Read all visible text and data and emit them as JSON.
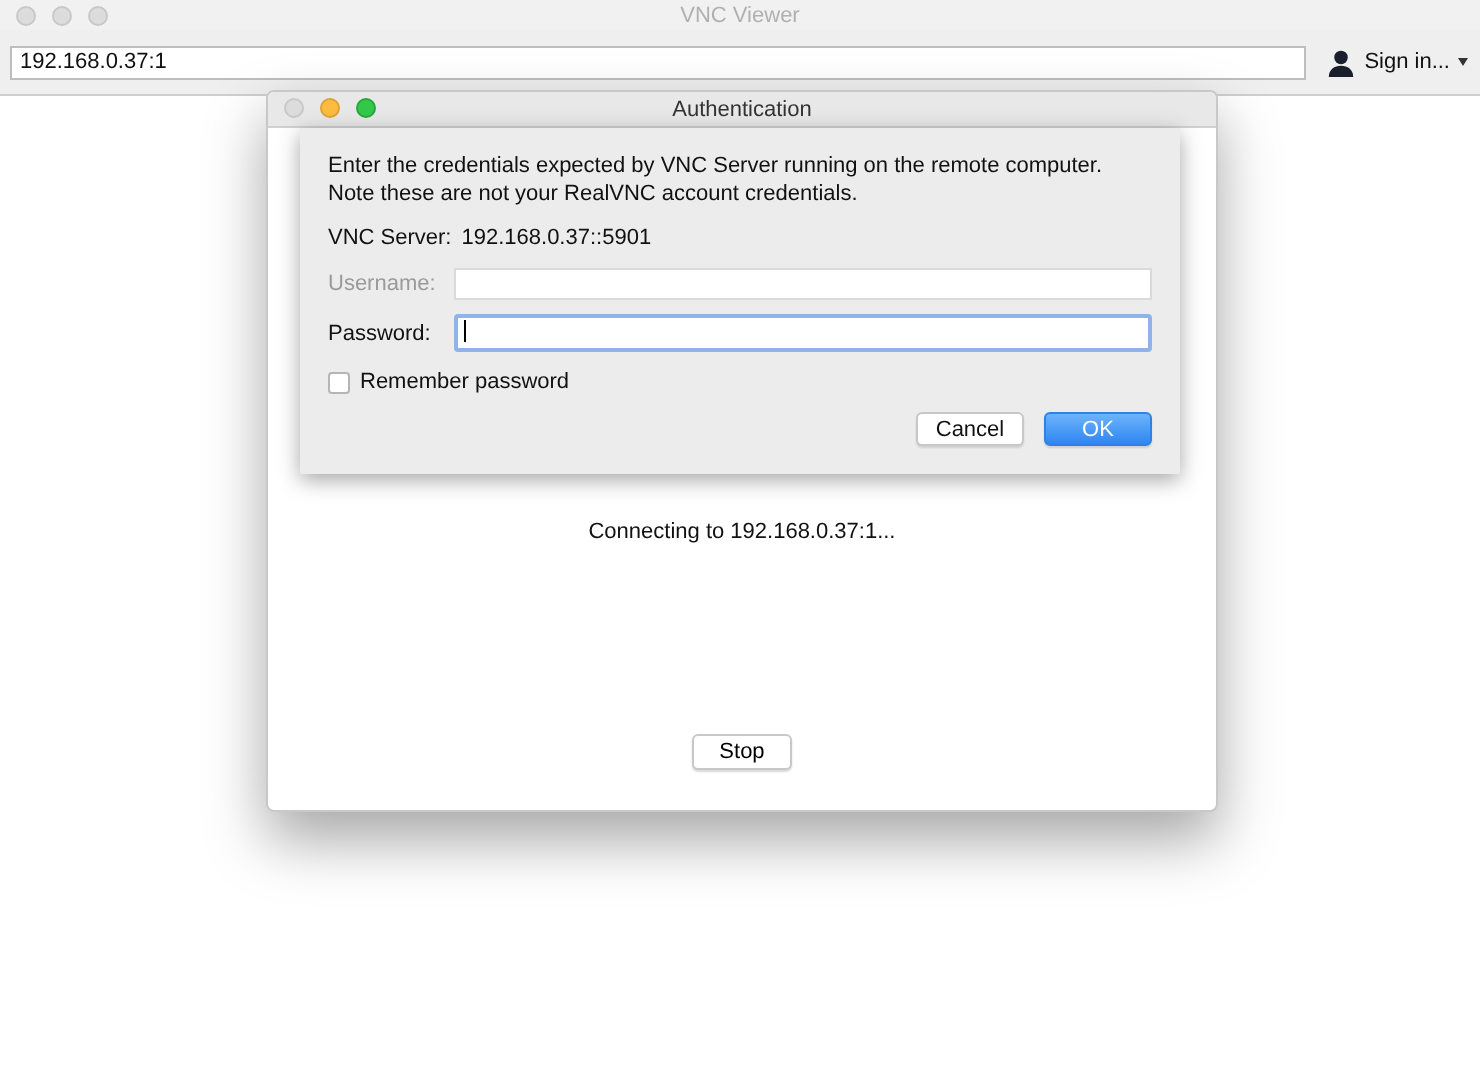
{
  "main_window": {
    "title": "VNC Viewer",
    "address": "192.168.0.37:1",
    "sign_in": "Sign in..."
  },
  "connection_window": {
    "title": "Authentication",
    "status": "Connecting to 192.168.0.37:1...",
    "stop_button": "Stop"
  },
  "auth_sheet": {
    "message_lines": [
      "Enter the credentials expected by VNC Server running on the remote computer.",
      "Note these are not your RealVNC account credentials."
    ],
    "server_label": "VNC Server:",
    "server_value": "192.168.0.37::5901",
    "username": {
      "label": "Username:",
      "disabled": true
    },
    "password": {
      "label": "Password:",
      "focused": true
    },
    "remember": {
      "label": "Remember password",
      "checked": false
    },
    "buttons": [
      {
        "label": "Cancel",
        "kind": "secondary"
      },
      {
        "label": "OK",
        "kind": "primary"
      }
    ]
  }
}
